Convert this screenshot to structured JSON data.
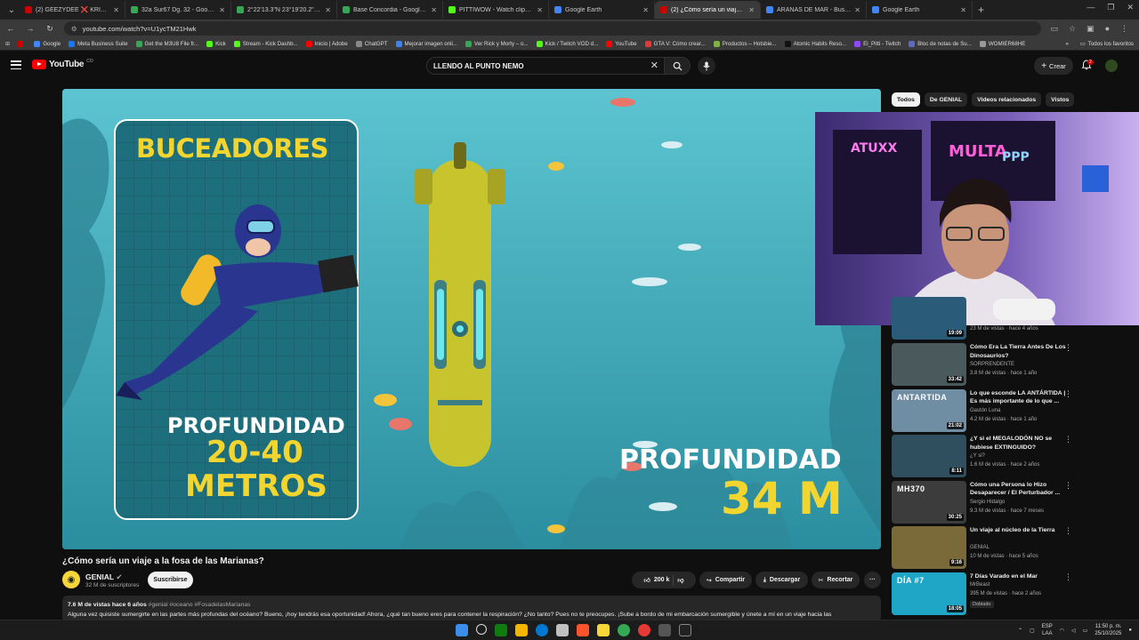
{
  "browser": {
    "tabs": [
      {
        "label": "(2) GEEZYDEE ❌ KRIS R - PARA",
        "color": "#cc0000",
        "active": false
      },
      {
        "label": "32a Sur67 Dg. 32 - Google Maps",
        "color": "#34a853",
        "active": false
      },
      {
        "label": "2°22'13.3\"N 23°19'20.2\"E - Goo",
        "color": "#34a853",
        "active": false
      },
      {
        "label": "Base Concordia - Google Maps",
        "color": "#34a853",
        "active": false
      },
      {
        "label": "PITTIWOW - Watch clips on Kick",
        "color": "#53fc18",
        "active": false
      },
      {
        "label": "Google Earth",
        "color": "#4285f4",
        "active": false
      },
      {
        "label": "(2) ¿Cómo sería un viaje a la fos",
        "color": "#cc0000",
        "active": true
      },
      {
        "label": "ARAÑAS DE MAR - Buscar con G",
        "color": "#4285f4",
        "active": false
      },
      {
        "label": "Google Earth",
        "color": "#4285f4",
        "active": false
      }
    ],
    "new_tab": "+",
    "url": "youtube.com/watch?v=U1ycTM21Hwk",
    "bookmarks": [
      {
        "label": "",
        "color": "#cc0000"
      },
      {
        "label": "Google",
        "color": "#4285f4"
      },
      {
        "label": "Meta Business Suite",
        "color": "#1877f2"
      },
      {
        "label": "Get the M3U8 File fr...",
        "color": "#34a853"
      },
      {
        "label": "Kick",
        "color": "#53fc18"
      },
      {
        "label": "Stream - Kick Dashb...",
        "color": "#53fc18"
      },
      {
        "label": "Inicio | Adobe",
        "color": "#ff0000"
      },
      {
        "label": "ChatGPT",
        "color": "#888888"
      },
      {
        "label": "Mejorar imagen onli...",
        "color": "#3b82f6"
      },
      {
        "label": "Ver Rick y Morty – o...",
        "color": "#34a853"
      },
      {
        "label": "Kick / Twitch VOD d...",
        "color": "#53fc18"
      },
      {
        "label": "YouTube",
        "color": "#ff0000"
      },
      {
        "label": "GTA V: Cómo crear...",
        "color": "#e53935"
      },
      {
        "label": "Productos – Hotsbie...",
        "color": "#7cb342"
      },
      {
        "label": "Atomic Habits Reso...",
        "color": "#111111"
      },
      {
        "label": "El_Pitti - Twitch",
        "color": "#9146ff"
      },
      {
        "label": "Bloc de notas de Su...",
        "color": "#5c6bc0"
      },
      {
        "label": "WOMIER68HE",
        "color": "#999999"
      }
    ],
    "all_bookmarks": "Todos los favoritos"
  },
  "youtube": {
    "logo": "YouTube",
    "country": "CO",
    "search_query": "LLENDO AL PUNTO NEMO",
    "create_label": "Crear",
    "notif_count": "2"
  },
  "video": {
    "overlay": {
      "divers": "BUCEADORES",
      "depth_label_1": "PROFUNDIDAD",
      "depth_value_1a": "20-40",
      "depth_value_1b": "METROS",
      "depth_label_2": "PROFUNDIDAD",
      "depth_value_2": "34 M"
    },
    "title": "¿Cómo sería un viaje a la fosa de las Marianas?",
    "channel": "GENIAL",
    "subscribers": "32 M de suscriptores",
    "subscribe": "Suscribirse",
    "likes": "200 k",
    "share": "Compartir",
    "download": "Descargar",
    "clip": "Recortar",
    "more": "···",
    "desc_meta": "7.6 M de vistas  hace 6 años",
    "desc_tags": "#genial #oceano #FosadelasMarianas",
    "desc_text": "Alguna vez quisiste sumergirte en las partes más profundas del océano? Bueno, ¡hoy tendrás esa oportunidad! Ahora, ¿qué tan bueno eres para contener la respiración? ¿No tanto? Pues no te preocupes. ¡Sube a bordo de mi embarcación sumergible y únete a mí en un viaje hacia las"
  },
  "sidebar": {
    "chips": [
      "Todos",
      "De GENIAL",
      "Videos relacionados",
      "Vistos"
    ],
    "partial": {
      "meta": "23 M de vistas · hace 4 años",
      "duration": "19:09"
    },
    "recommendations": [
      {
        "title": "Cómo Era La Tierra Antes De Los Dinosaurios?",
        "channel": "SORPRENDENTE",
        "meta": "3.8 M de vistas · hace 1 año",
        "duration": "33:42",
        "thumb": "#4a5a5c",
        "badge": "",
        "thumb_text": ""
      },
      {
        "title": "Lo que esconde LA ANTÁRTIDA | Es más importante de lo que ...",
        "channel": "Gastón Luna",
        "meta": "4.2 M de vistas · hace 1 año",
        "duration": "21:02",
        "thumb": "#6f8da3",
        "badge": "",
        "thumb_text": "ANTARTIDA"
      },
      {
        "title": "¿Y si el MEGALODÓN NO se hubiese EXTINGUIDO?",
        "channel": "¿Y si?",
        "meta": "1.6 M de vistas · hace 2 años",
        "duration": "8:11",
        "thumb": "#2f4f5f",
        "badge": "",
        "thumb_text": ""
      },
      {
        "title": "Cómo una Persona lo Hizo Desaparecer / El Perturbador ...",
        "channel": "Sergio Hidalgo",
        "meta": "9.3 M de vistas · hace 7 meses",
        "duration": "30:25",
        "thumb": "#3c3c3c",
        "badge": "",
        "thumb_text": "MH370"
      },
      {
        "title": "Un viaje al núcleo de la Tierra",
        "channel": "GENIAL",
        "meta": "10 M de vistas · hace 5 años",
        "duration": "9:16",
        "thumb": "#7a6a3a",
        "badge": "",
        "thumb_text": ""
      },
      {
        "title": "7 Días Varado en el Mar",
        "channel": "MrBeast",
        "meta": "395 M de vistas · hace 2 años",
        "duration": "18:05",
        "thumb": "#1fa6c7",
        "badge": "Doblado",
        "thumb_text": "DÍA #7"
      }
    ]
  },
  "taskbar": {
    "lang": "ESP",
    "lang2": "LAA",
    "time": "11:50 p. m.",
    "date": "25/10/2025"
  }
}
